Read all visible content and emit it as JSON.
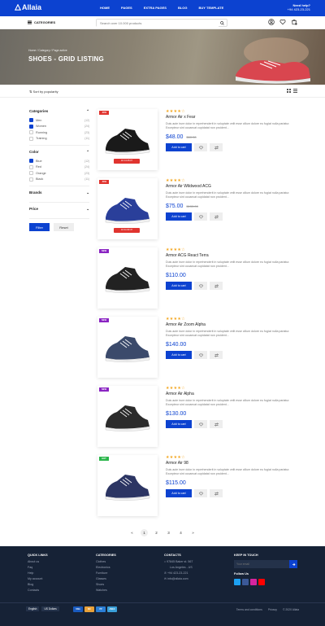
{
  "header": {
    "logo": "Allaia",
    "nav": [
      "HOME",
      "PAGES",
      "EXTRA PAGES",
      "BLOG",
      "BUY TEMPLATE"
    ],
    "help_title": "Need help?",
    "help_phone": "+94 423-23-221"
  },
  "toolbar": {
    "categories_label": "CATEGORIES",
    "search_placeholder": "Search over 10.000 products"
  },
  "hero": {
    "breadcrumb": [
      "Home",
      "Category",
      "Page active"
    ],
    "title": "SHOES - GRID LISTING"
  },
  "sort": {
    "label": "Sort by popularity"
  },
  "filters": {
    "categories_title": "Categories",
    "categories": [
      {
        "label": "Men",
        "count": "(12)",
        "checked": true
      },
      {
        "label": "Women",
        "count": "(24)",
        "checked": true
      },
      {
        "label": "Running",
        "count": "(23)",
        "checked": false
      },
      {
        "label": "Training",
        "count": "(11)",
        "checked": false
      }
    ],
    "color_title": "Color",
    "colors": [
      {
        "label": "Blue",
        "count": "(12)",
        "checked": true
      },
      {
        "label": "Red",
        "count": "(24)",
        "checked": false
      },
      {
        "label": "Orange",
        "count": "(23)",
        "checked": false
      },
      {
        "label": "Black",
        "count": "(11)",
        "checked": false
      }
    ],
    "brands_title": "Brands",
    "price_title": "Price",
    "filter_btn": "Filter",
    "reset_btn": "Reset"
  },
  "product_common": {
    "stars": "★★★★☆",
    "description": "Duis aute irure dolor in reprehenderit in voluptate velit esse cillum dolore eu fugiat nulla pariatur. Excepteur sint occaecat cupidatat non proident...",
    "add_to_cart": "Add to cart"
  },
  "products": [
    {
      "name": "Armor Air x Fear",
      "price": "$48.00",
      "old_price": "$60.00",
      "badge": "-30%",
      "badge_color": "#e0342f",
      "timer": "1D 13:25:07",
      "shoe_color": "#1a1a1a"
    },
    {
      "name": "Armor Air Wildwood ACG",
      "price": "$75.00",
      "old_price": "$155.00",
      "badge": "-50%",
      "badge_color": "#e0342f",
      "timer": "1D 11:03:47",
      "shoe_color": "#2a3f9a"
    },
    {
      "name": "Armor ACG React Terra",
      "price": "$110.00",
      "old_price": "",
      "badge": "NEW",
      "badge_color": "#8a24c2",
      "timer": "",
      "shoe_color": "#222222"
    },
    {
      "name": "Armor Air Zoom Alpha",
      "price": "$140.00",
      "old_price": "",
      "badge": "NEW",
      "badge_color": "#8a24c2",
      "timer": "",
      "shoe_color": "#3b4a6b"
    },
    {
      "name": "Armor Air Alpha",
      "price": "$130.00",
      "old_price": "",
      "badge": "NEW",
      "badge_color": "#8a24c2",
      "timer": "",
      "shoe_color": "#2b2b2b"
    },
    {
      "name": "Armor Air 98",
      "price": "$115.00",
      "old_price": "",
      "badge": "HOT",
      "badge_color": "#2ab54a",
      "timer": "",
      "shoe_color": "#2c3563"
    }
  ],
  "pagination": [
    "«",
    "1",
    "2",
    "3",
    "4",
    "»"
  ],
  "footer": {
    "quick_title": "QUICK LINKS",
    "quick": [
      "About us",
      "Faq",
      "Help",
      "My account",
      "Blog",
      "Contacts"
    ],
    "cat_title": "CATEGORIES",
    "cats": [
      "Clothes",
      "Electronics",
      "Furniture",
      "Glasses",
      "Shoes",
      "Watches"
    ],
    "contacts_title": "CONTACTS",
    "address_1": "97845 Baker st. 567",
    "address_2": "Los Angeles - US",
    "phone": "+94 423-23-221",
    "email": "info@allaia.com",
    "touch_title": "KEEP IN TOUCH",
    "email_placeholder": "Your email",
    "follow": "Follow Us",
    "lang": "English",
    "currency": "US Dollars",
    "payments": [
      "VISA",
      "MC",
      "PP",
      "AMEX"
    ],
    "links": [
      "Terms and conditions",
      "Privacy",
      "© 2020 Allaia"
    ]
  }
}
